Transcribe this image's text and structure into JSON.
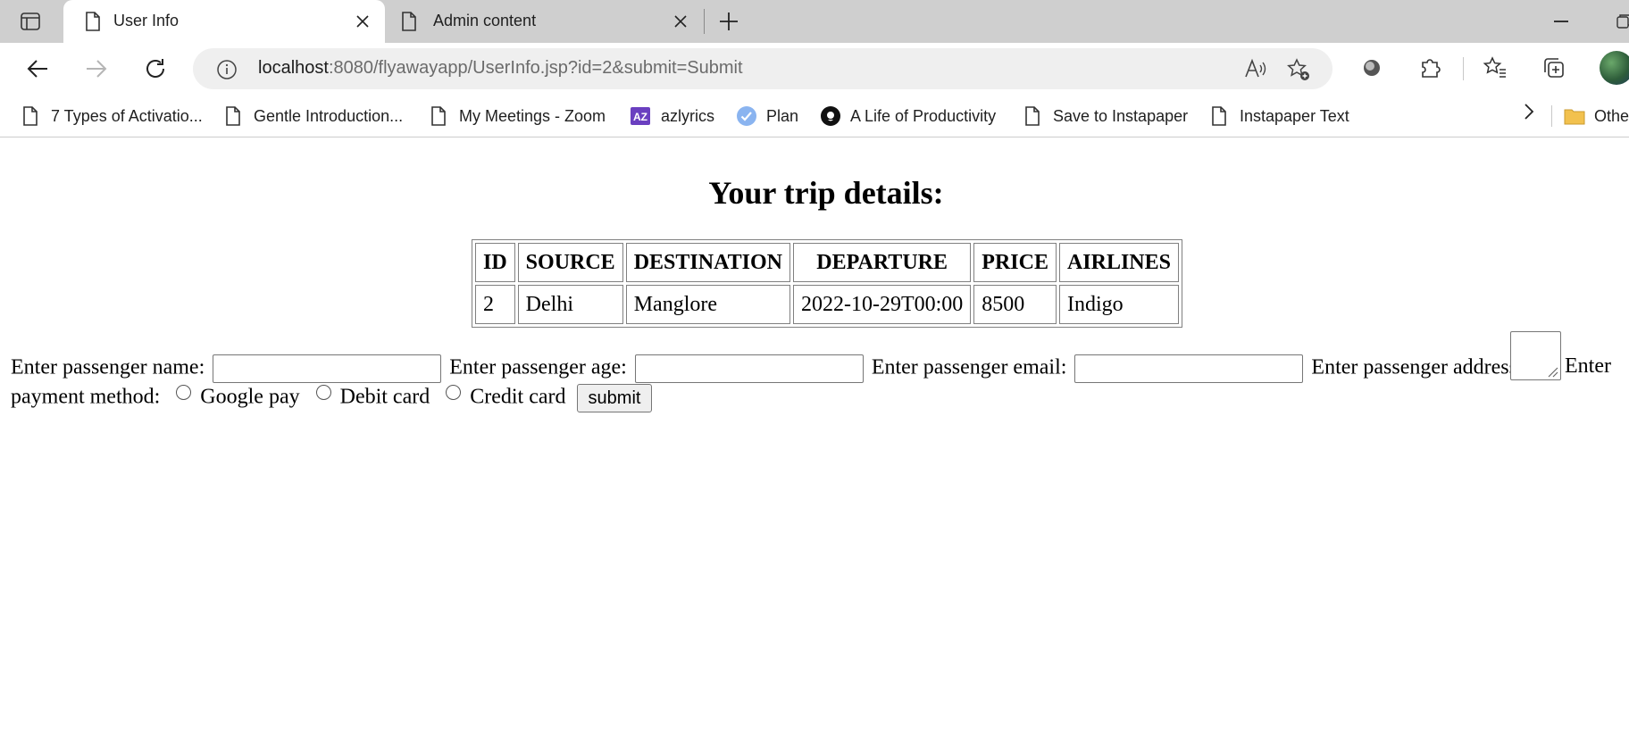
{
  "tabs": [
    {
      "title": "User Info",
      "active": true
    },
    {
      "title": "Admin content",
      "active": false
    }
  ],
  "address": {
    "host": "localhost",
    "rest": ":8080/flyawayapp/UserInfo.jsp?id=2&submit=Submit"
  },
  "bookmarks": [
    {
      "label": "7 Types of Activatio...",
      "icon": "page-icon"
    },
    {
      "label": "Gentle Introduction...",
      "icon": "page-icon"
    },
    {
      "label": "My Meetings - Zoom",
      "icon": "page-icon"
    },
    {
      "label": "azlyrics",
      "icon": "azlyrics-icon"
    },
    {
      "label": "Plan",
      "icon": "check-circle-icon"
    },
    {
      "label": "A Life of Productivity",
      "icon": "productivity-icon"
    },
    {
      "label": "Save to Instapaper",
      "icon": "page-icon"
    },
    {
      "label": "Instapaper Text",
      "icon": "page-icon"
    }
  ],
  "bookmarks_other": "Othe",
  "page": {
    "heading": "Your trip details:",
    "table": {
      "headers": [
        "ID",
        "SOURCE",
        "DESTINATION",
        "DEPARTURE",
        "PRICE",
        "AIRLINES"
      ],
      "rows": [
        [
          "2",
          "Delhi",
          "Manglore",
          "2022-10-29T00:00",
          "8500",
          "Indigo"
        ]
      ]
    },
    "form": {
      "name_label": "Enter passenger name:",
      "age_label": "Enter passenger age:",
      "email_label": "Enter passenger email:",
      "address_label": "Enter passenger address:",
      "payment_label_line1": "Enter",
      "payment_label_line2": "payment method:",
      "payment_options": [
        "Google pay",
        "Debit card",
        "Credit card"
      ],
      "submit_label": "submit"
    }
  }
}
